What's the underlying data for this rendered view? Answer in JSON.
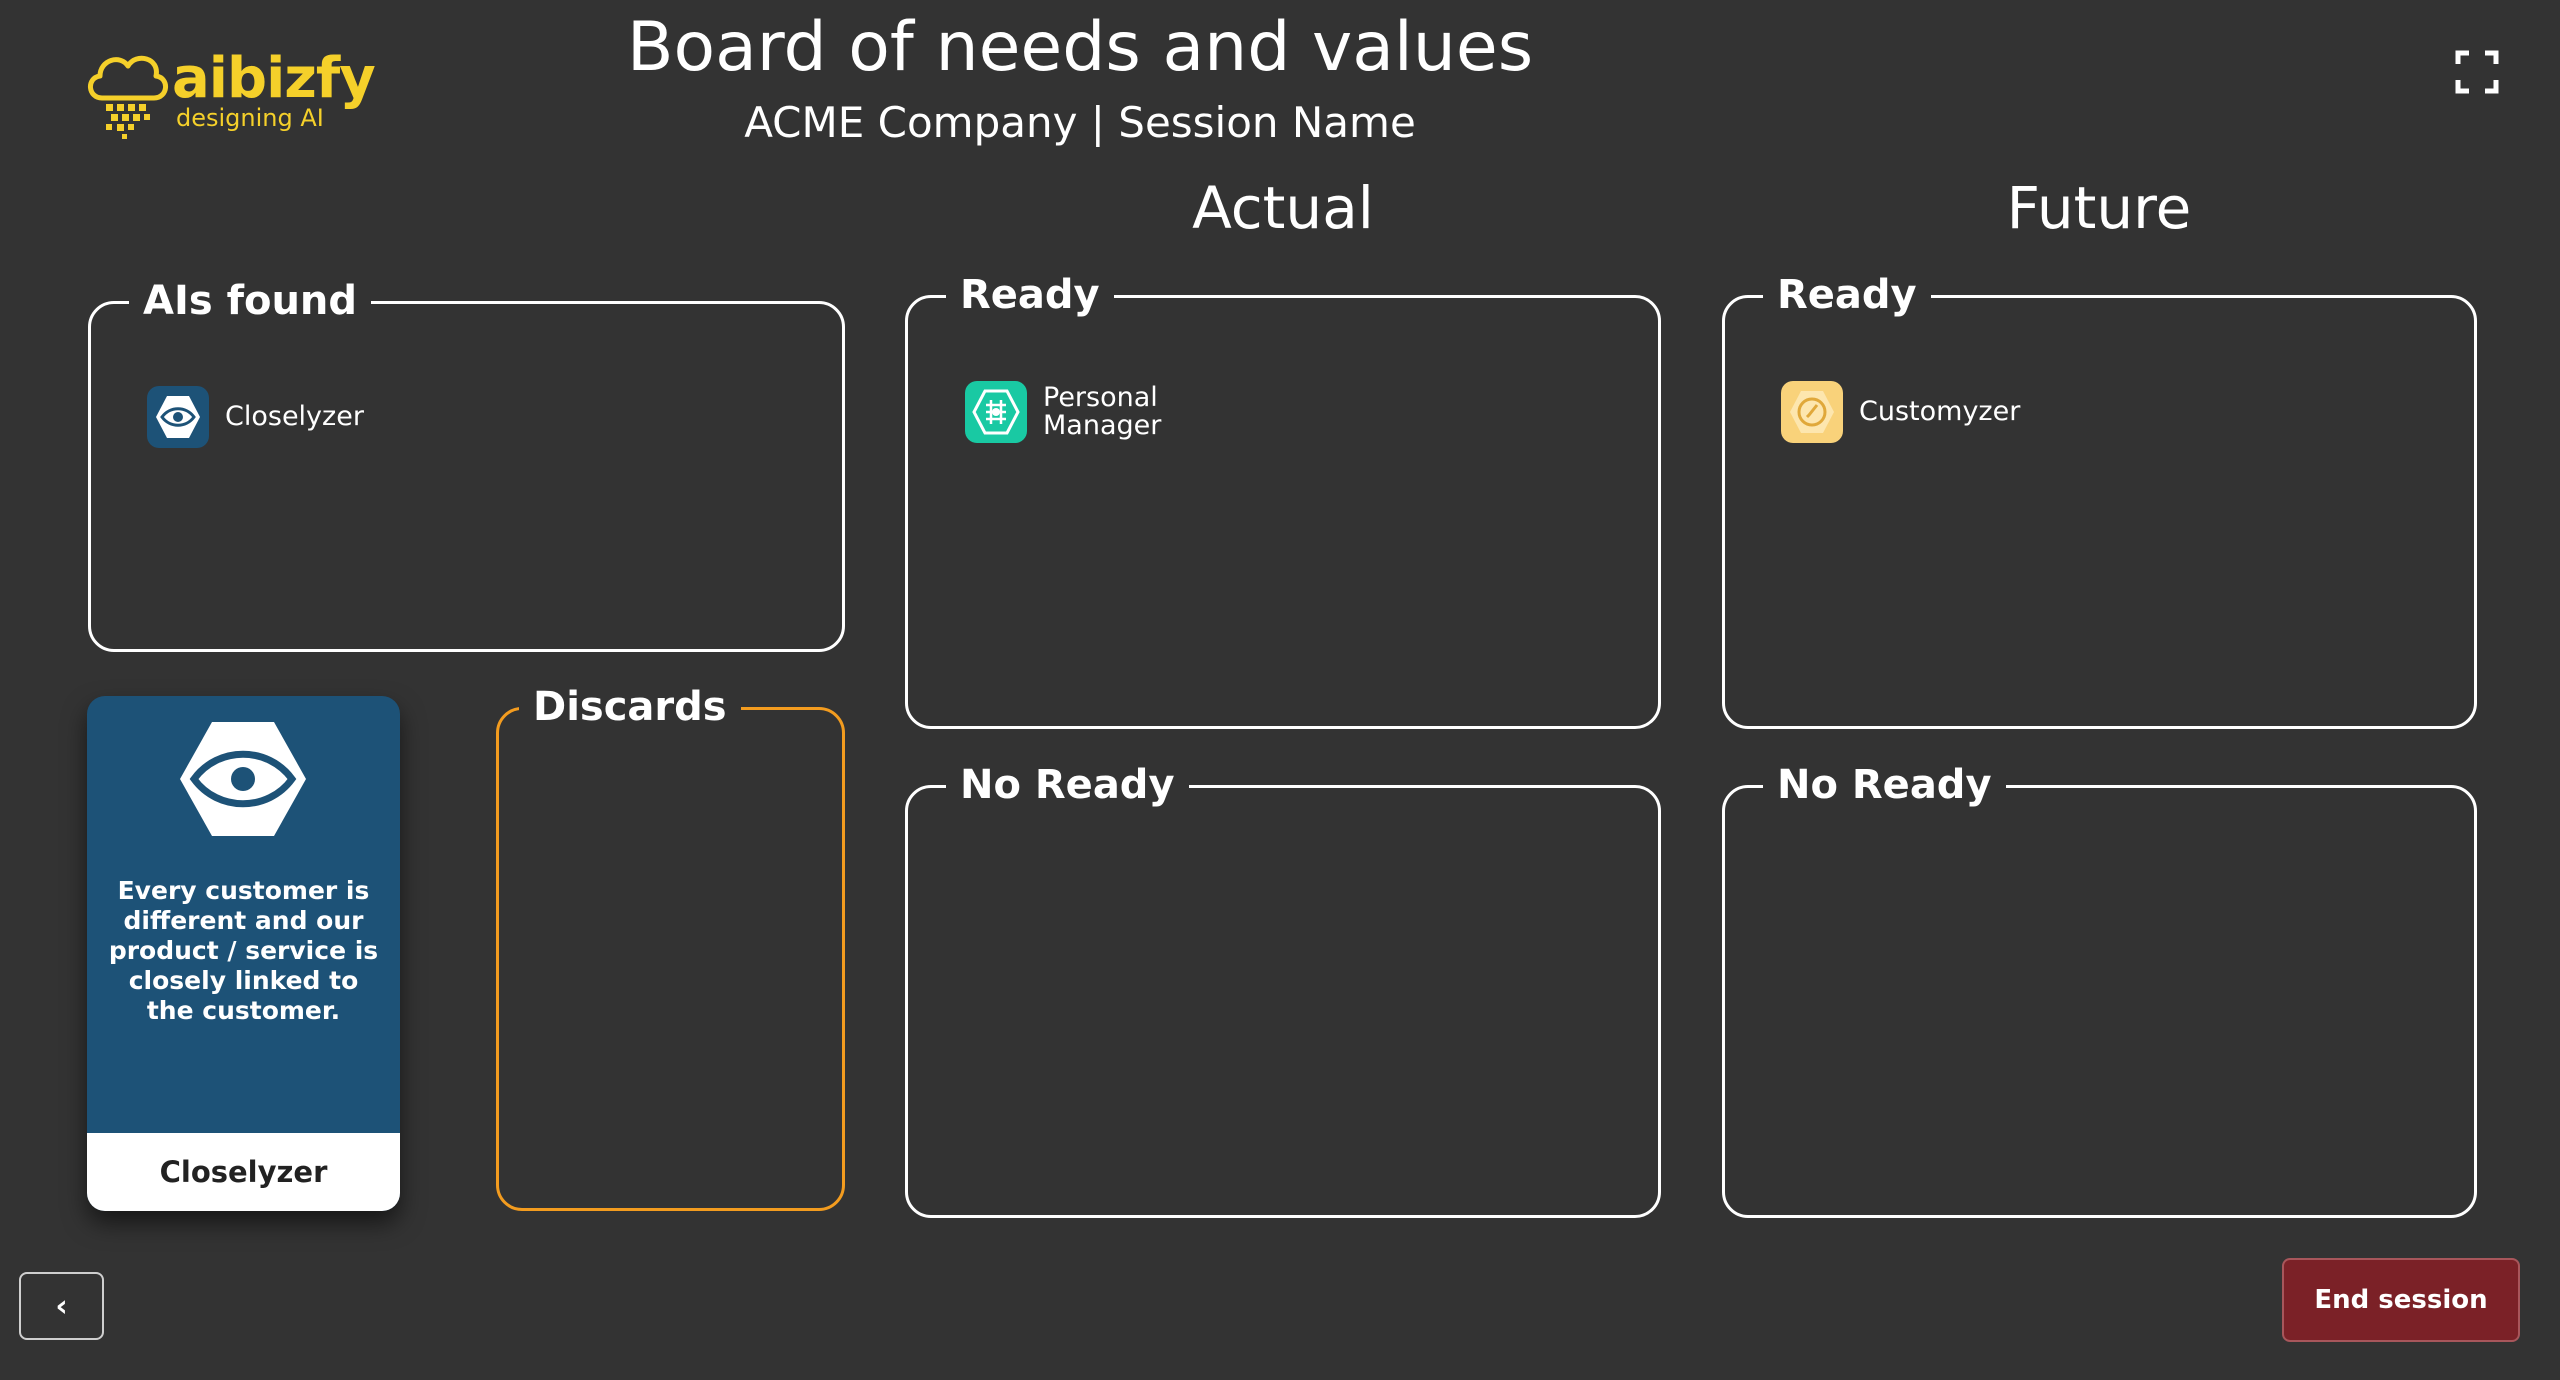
{
  "brand": {
    "name": "aibizfy",
    "tagline": "designing AI",
    "color": "#f5d02a",
    "icon": "cloud-rain-logo-icon"
  },
  "header": {
    "title": "Board of needs and values",
    "subtitle": "ACME Company | Session Name",
    "fullscreen_icon": "fullscreen-icon"
  },
  "columns": {
    "actual": "Actual",
    "future": "Future"
  },
  "ais_found": {
    "label": "AIs found",
    "items": [
      {
        "label": "Closelyzer",
        "icon": "eye-icon",
        "color": "#1d5277"
      }
    ]
  },
  "discards": {
    "label": "Discards",
    "border_color": "#f39c1f"
  },
  "actual_ready": {
    "label": "Ready",
    "items": [
      {
        "label_line1": "Personal",
        "label_line2": "Manager",
        "icon": "brain-chip-icon",
        "color": "#19c9a3"
      }
    ]
  },
  "actual_no_ready": {
    "label": "No Ready"
  },
  "future_ready": {
    "label": "Ready",
    "items": [
      {
        "label": "Customyzer",
        "icon": "compass-icon",
        "color": "#f9d27a"
      }
    ]
  },
  "future_no_ready": {
    "label": "No Ready"
  },
  "selected_card": {
    "icon": "eye-icon",
    "description": "Every customer is different and our product / service is closely linked to the customer.",
    "name": "Closelyzer",
    "color": "#1d5277"
  },
  "footer": {
    "back_label": "‹",
    "end_session_label": "End session",
    "end_session_color": "#7b2127"
  }
}
